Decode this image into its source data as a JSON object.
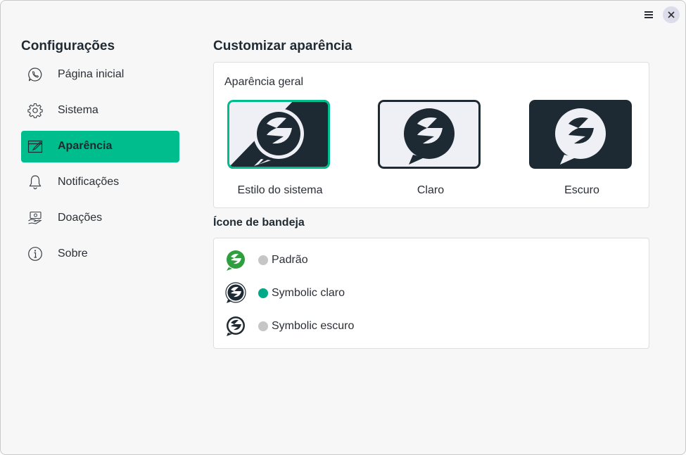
{
  "sidebar": {
    "title": "Configurações",
    "items": [
      {
        "label": "Página inicial",
        "icon": "whatsapp-icon"
      },
      {
        "label": "Sistema",
        "icon": "gear-icon"
      },
      {
        "label": "Aparência",
        "icon": "edit-icon",
        "active": true
      },
      {
        "label": "Notificações",
        "icon": "bell-icon"
      },
      {
        "label": "Doações",
        "icon": "donation-icon"
      },
      {
        "label": "Sobre",
        "icon": "info-icon"
      }
    ]
  },
  "header": {
    "menu_icon": "hamburger-icon",
    "close_icon": "close-icon"
  },
  "main": {
    "title": "Customizar aparência",
    "appearance": {
      "title": "Aparência geral",
      "options": [
        {
          "label": "Estilo do sistema",
          "selected": true
        },
        {
          "label": "Claro"
        },
        {
          "label": "Escuro"
        }
      ]
    },
    "tray": {
      "title": "Ícone de bandeja",
      "options": [
        {
          "label": "Padrão",
          "selected": false
        },
        {
          "label": "Symbolic claro",
          "selected": true
        },
        {
          "label": "Symbolic escuro",
          "selected": false
        }
      ]
    }
  },
  "colors": {
    "accent": "#00bd8e",
    "dark": "#1e2a33",
    "light": "#eef0f5"
  }
}
